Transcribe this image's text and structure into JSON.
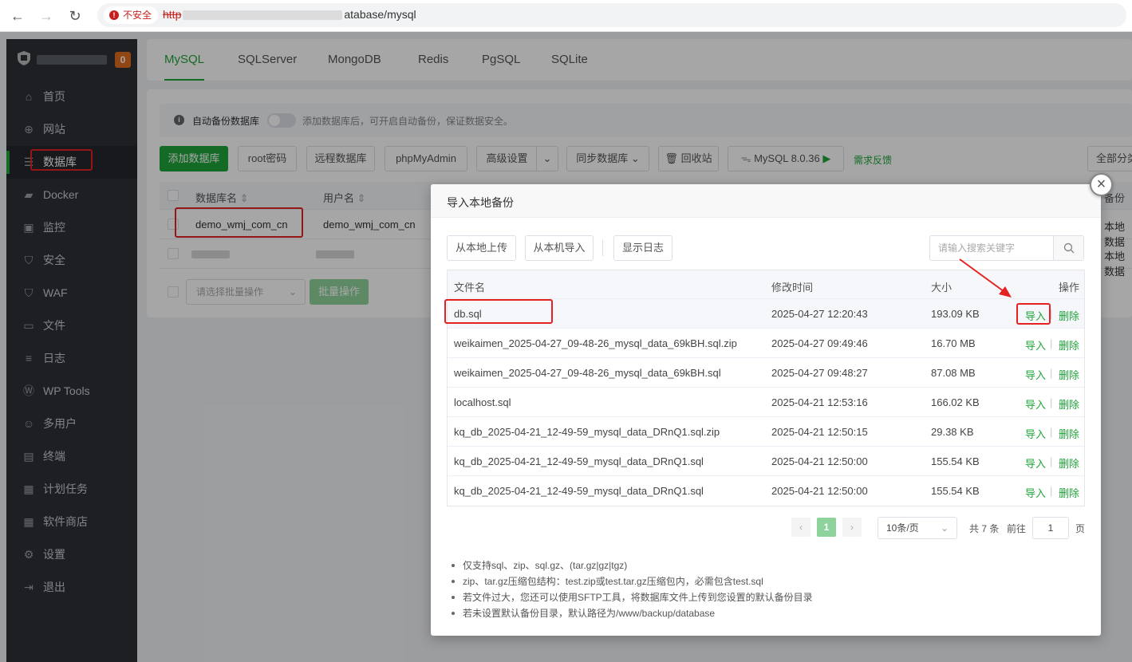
{
  "browser": {
    "insecure_label": "不安全",
    "url_proto": "http",
    "url_tail": "atabase/mysql"
  },
  "sidebar": {
    "badge": "0",
    "items": [
      {
        "label": "首页",
        "icon": "home-icon"
      },
      {
        "label": "网站",
        "icon": "globe-icon"
      },
      {
        "label": "数据库",
        "icon": "database-icon"
      },
      {
        "label": "Docker",
        "icon": "docker-icon"
      },
      {
        "label": "监控",
        "icon": "monitor-icon"
      },
      {
        "label": "安全",
        "icon": "shield-icon"
      },
      {
        "label": "WAF",
        "icon": "waf-shield-icon"
      },
      {
        "label": "文件",
        "icon": "folder-icon"
      },
      {
        "label": "日志",
        "icon": "log-icon"
      },
      {
        "label": "WP Tools",
        "icon": "wordpress-icon"
      },
      {
        "label": "多用户",
        "icon": "users-icon"
      },
      {
        "label": "终端",
        "icon": "terminal-icon"
      },
      {
        "label": "计划任务",
        "icon": "calendar-icon"
      },
      {
        "label": "软件商店",
        "icon": "grid-icon"
      },
      {
        "label": "设置",
        "icon": "gear-icon"
      },
      {
        "label": "退出",
        "icon": "logout-icon"
      }
    ]
  },
  "tabs": [
    "MySQL",
    "SQLServer",
    "MongoDB",
    "Redis",
    "PgSQL",
    "SQLite"
  ],
  "notice": {
    "label": "自动备份数据库",
    "hint": "添加数据库后，可开启自动备份，保证数据安全。"
  },
  "toolbar": {
    "add_db": "添加数据库",
    "root_pwd": "root密码",
    "remote_db": "远程数据库",
    "phpmyadmin": "phpMyAdmin",
    "advanced": "高级设置",
    "sync_db": "同步数据库",
    "recycle": "回收站",
    "mysql_version": "MySQL 8.0.36",
    "feedback": "需求反馈",
    "all_categories": "全部分类"
  },
  "db_table": {
    "col_name": "数据库名",
    "col_user": "用户名",
    "col_backup": "备份",
    "rows": [
      {
        "name": "demo_wmj_com_cn",
        "user": "demo_wmj_com_cn",
        "backup": "本地数据"
      },
      {
        "name": "",
        "user": "",
        "backup": "本地数据"
      }
    ],
    "batch_placeholder": "请选择批量操作",
    "batch_btn": "批量操作"
  },
  "dialog": {
    "title": "导入本地备份",
    "btn_upload": "从本地上传",
    "btn_import_local": "从本机导入",
    "btn_show_log": "显示日志",
    "search_placeholder": "请输入搜索关键字",
    "columns": {
      "name": "文件名",
      "mtime": "修改时间",
      "size": "大小",
      "ops": "操作"
    },
    "files": [
      {
        "name": "db.sql",
        "mtime": "2025-04-27 12:20:43",
        "size": "193.09 KB"
      },
      {
        "name": "weikaimen_2025-04-27_09-48-26_mysql_data_69kBH.sql.zip",
        "mtime": "2025-04-27 09:49:46",
        "size": "16.70 MB"
      },
      {
        "name": "weikaimen_2025-04-27_09-48-26_mysql_data_69kBH.sql",
        "mtime": "2025-04-27 09:48:27",
        "size": "87.08 MB"
      },
      {
        "name": "localhost.sql",
        "mtime": "2025-04-21 12:53:16",
        "size": "166.02 KB"
      },
      {
        "name": "kq_db_2025-04-21_12-49-59_mysql_data_DRnQ1.sql.zip",
        "mtime": "2025-04-21 12:50:15",
        "size": "29.38 KB"
      },
      {
        "name": "kq_db_2025-04-21_12-49-59_mysql_data_DRnQ1.sql",
        "mtime": "2025-04-21 12:50:00",
        "size": "155.54 KB"
      },
      {
        "name": "kq_db_2025-04-21_12-49-59_mysql_data_DRnQ1.sql",
        "mtime": "2025-04-21 12:50:00",
        "size": "155.54 KB"
      }
    ],
    "action_import": "导入",
    "action_delete": "删除",
    "pager": {
      "prev": "‹",
      "current": "1",
      "next": "›",
      "page_size": "10条/页",
      "total": "共 7 条",
      "goto": "前往",
      "goto_value": "1",
      "page_unit": "页"
    },
    "notes": [
      "仅支持sql、zip、sql.gz、(tar.gz|gz|tgz)",
      "zip、tar.gz压缩包结构：test.zip或test.tar.gz压缩包内，必需包含test.sql",
      "若文件过大，您还可以使用SFTP工具，将数据库文件上传到您设置的默认备份目录",
      "若未设置默认备份目录，默认路径为/www/backup/database"
    ]
  },
  "colors": {
    "accent": "#20a53a",
    "sidebar_bg": "#2e3137",
    "highlight_red": "#e52222"
  }
}
